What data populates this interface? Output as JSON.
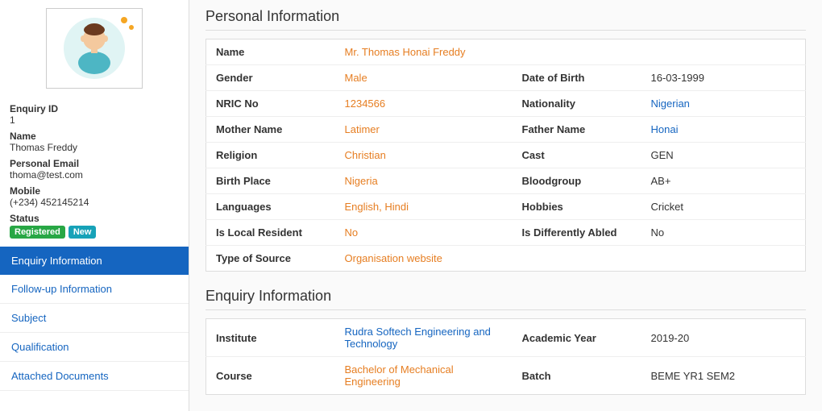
{
  "sidebar": {
    "enquiry_id_label": "Enquiry ID",
    "enquiry_id_value": "1",
    "name_label": "Name",
    "name_value": "Thomas Freddy",
    "email_label": "Personal Email",
    "email_value": "thoma@test.com",
    "mobile_label": "Mobile",
    "mobile_value": "(+234) 452145214",
    "status_label": "Status",
    "badge_registered": "Registered",
    "badge_new": "New",
    "nav_items": [
      {
        "label": "Enquiry Information",
        "active": true
      },
      {
        "label": "Follow-up Information",
        "active": false
      },
      {
        "label": "Subject",
        "active": false
      },
      {
        "label": "Qualification",
        "active": false
      },
      {
        "label": "Attached Documents",
        "active": false
      }
    ]
  },
  "personal_info": {
    "section_title": "Personal Information",
    "rows": [
      {
        "col1_label": "Name",
        "col1_value": "Mr. Thomas Honai Freddy",
        "col1_value_class": "val",
        "span": true
      },
      {
        "col1_label": "Gender",
        "col1_value": "Male",
        "col1_value_class": "val",
        "col2_label": "Date of Birth",
        "col2_value": "16-03-1999",
        "col2_value_class": "val2"
      },
      {
        "col1_label": "NRIC No",
        "col1_value": "1234566",
        "col1_value_class": "val",
        "col2_label": "Nationality",
        "col2_value": "Nigerian",
        "col2_value_class": "val-link"
      },
      {
        "col1_label": "Mother Name",
        "col1_value": "Latimer",
        "col1_value_class": "val",
        "col2_label": "Father Name",
        "col2_value": "Honai",
        "col2_value_class": "val-link"
      },
      {
        "col1_label": "Religion",
        "col1_value": "Christian",
        "col1_value_class": "val",
        "col2_label": "Cast",
        "col2_value": "GEN",
        "col2_value_class": "val2"
      },
      {
        "col1_label": "Birth Place",
        "col1_value": "Nigeria",
        "col1_value_class": "val",
        "col2_label": "Bloodgroup",
        "col2_value": "AB+",
        "col2_value_class": "val2"
      },
      {
        "col1_label": "Languages",
        "col1_value": "English, Hindi",
        "col1_value_class": "val",
        "col2_label": "Hobbies",
        "col2_value": "Cricket",
        "col2_value_class": "val2"
      },
      {
        "col1_label": "Is Local Resident",
        "col1_value": "No",
        "col1_value_class": "val",
        "col2_label": "Is Differently Abled",
        "col2_value": "No",
        "col2_value_class": "val2"
      },
      {
        "col1_label": "Type of Source",
        "col1_value": "Organisation website",
        "col1_value_class": "val",
        "span": true
      }
    ]
  },
  "enquiry_info": {
    "section_title": "Enquiry Information",
    "rows": [
      {
        "col1_label": "Institute",
        "col1_value": "Rudra Softech Engineering and Technology",
        "col1_value_class": "val-link",
        "col2_label": "Academic Year",
        "col2_value": "2019-20",
        "col2_value_class": "val2"
      },
      {
        "col1_label": "Course",
        "col1_value": "Bachelor of Mechanical Engineering",
        "col1_value_class": "val",
        "col2_label": "Batch",
        "col2_value": "BEME YR1 SEM2",
        "col2_value_class": "val2"
      }
    ]
  }
}
